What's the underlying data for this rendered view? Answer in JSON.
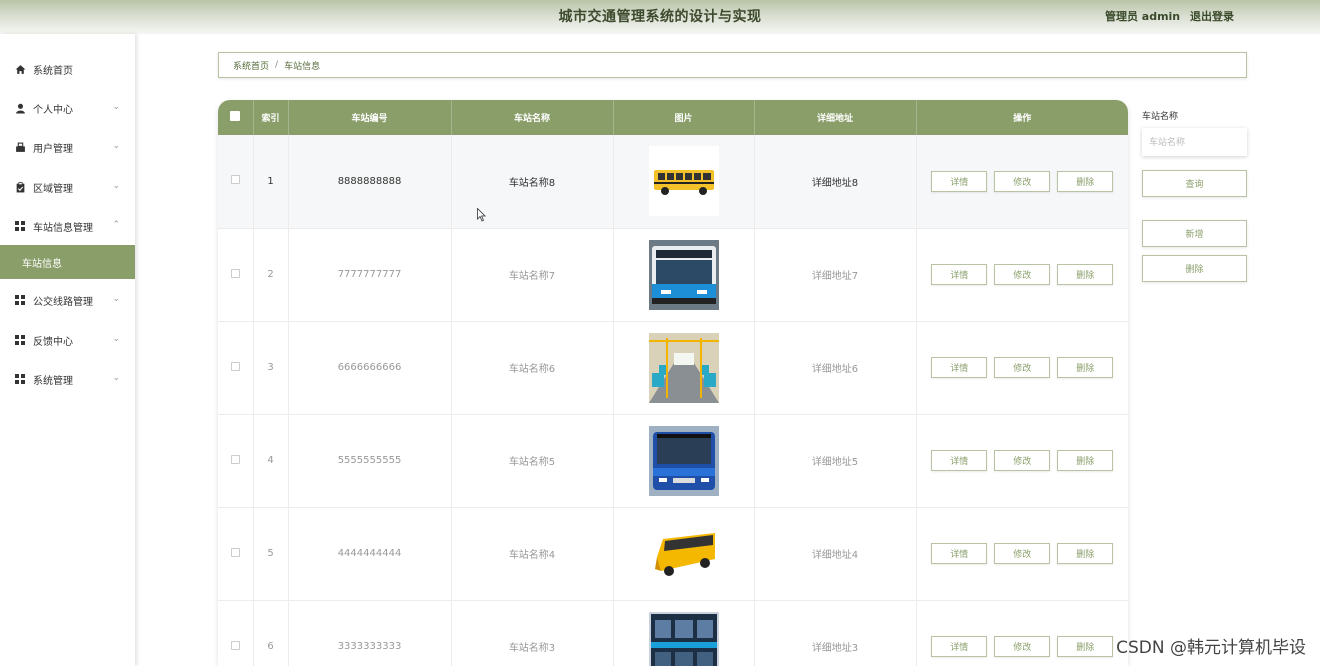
{
  "header": {
    "title": "城市交通管理系统的设计与实现",
    "user_label": "管理员 admin",
    "logout": "退出登录"
  },
  "sidebar": {
    "items": [
      {
        "label": "系统首页",
        "icon": "home-icon"
      },
      {
        "label": "个人中心",
        "icon": "user-icon"
      },
      {
        "label": "用户管理",
        "icon": "users-icon"
      },
      {
        "label": "区域管理",
        "icon": "clipboard-icon"
      },
      {
        "label": "车站信息管理",
        "icon": "grid-icon"
      },
      {
        "label": "公交线路管理",
        "icon": "grid-icon"
      },
      {
        "label": "反馈中心",
        "icon": "grid-icon"
      },
      {
        "label": "系统管理",
        "icon": "grid-icon"
      }
    ],
    "active_sub": "车站信息"
  },
  "breadcrumb": {
    "home": "系统首页",
    "sep": "/",
    "current": "车站信息"
  },
  "table": {
    "columns": [
      "索引",
      "车站编号",
      "车站名称",
      "图片",
      "详细地址",
      "操作"
    ],
    "rows": [
      {
        "index": "1",
        "code": "8888888888",
        "name": "车站名称8",
        "address": "详细地址8",
        "image": "yellow-school-bus"
      },
      {
        "index": "2",
        "code": "7777777777",
        "name": "车站名称7",
        "address": "详细地址7",
        "image": "blue-white-bus"
      },
      {
        "index": "3",
        "code": "6666666666",
        "name": "车站名称6",
        "address": "详细地址6",
        "image": "bus-interior"
      },
      {
        "index": "4",
        "code": "5555555555",
        "name": "车站名称5",
        "address": "详细地址5",
        "image": "blue-city-bus"
      },
      {
        "index": "5",
        "code": "4444444444",
        "name": "车站名称4",
        "address": "详细地址4",
        "image": "yellow-toy-bus"
      },
      {
        "index": "6",
        "code": "3333333333",
        "name": "车站名称3",
        "address": "详细地址3",
        "image": "blue-double-bus"
      }
    ],
    "actions": {
      "detail": "详情",
      "edit": "修改",
      "delete": "删除"
    }
  },
  "search": {
    "label": "车站名称",
    "placeholder": "车站名称",
    "query_button": "查询",
    "add_button": "新增",
    "delete_button": "删除"
  },
  "watermark": "CSDN @韩元计算机毕设",
  "colors": {
    "accent": "#8a9e6a",
    "border": "#b7c3a3"
  }
}
